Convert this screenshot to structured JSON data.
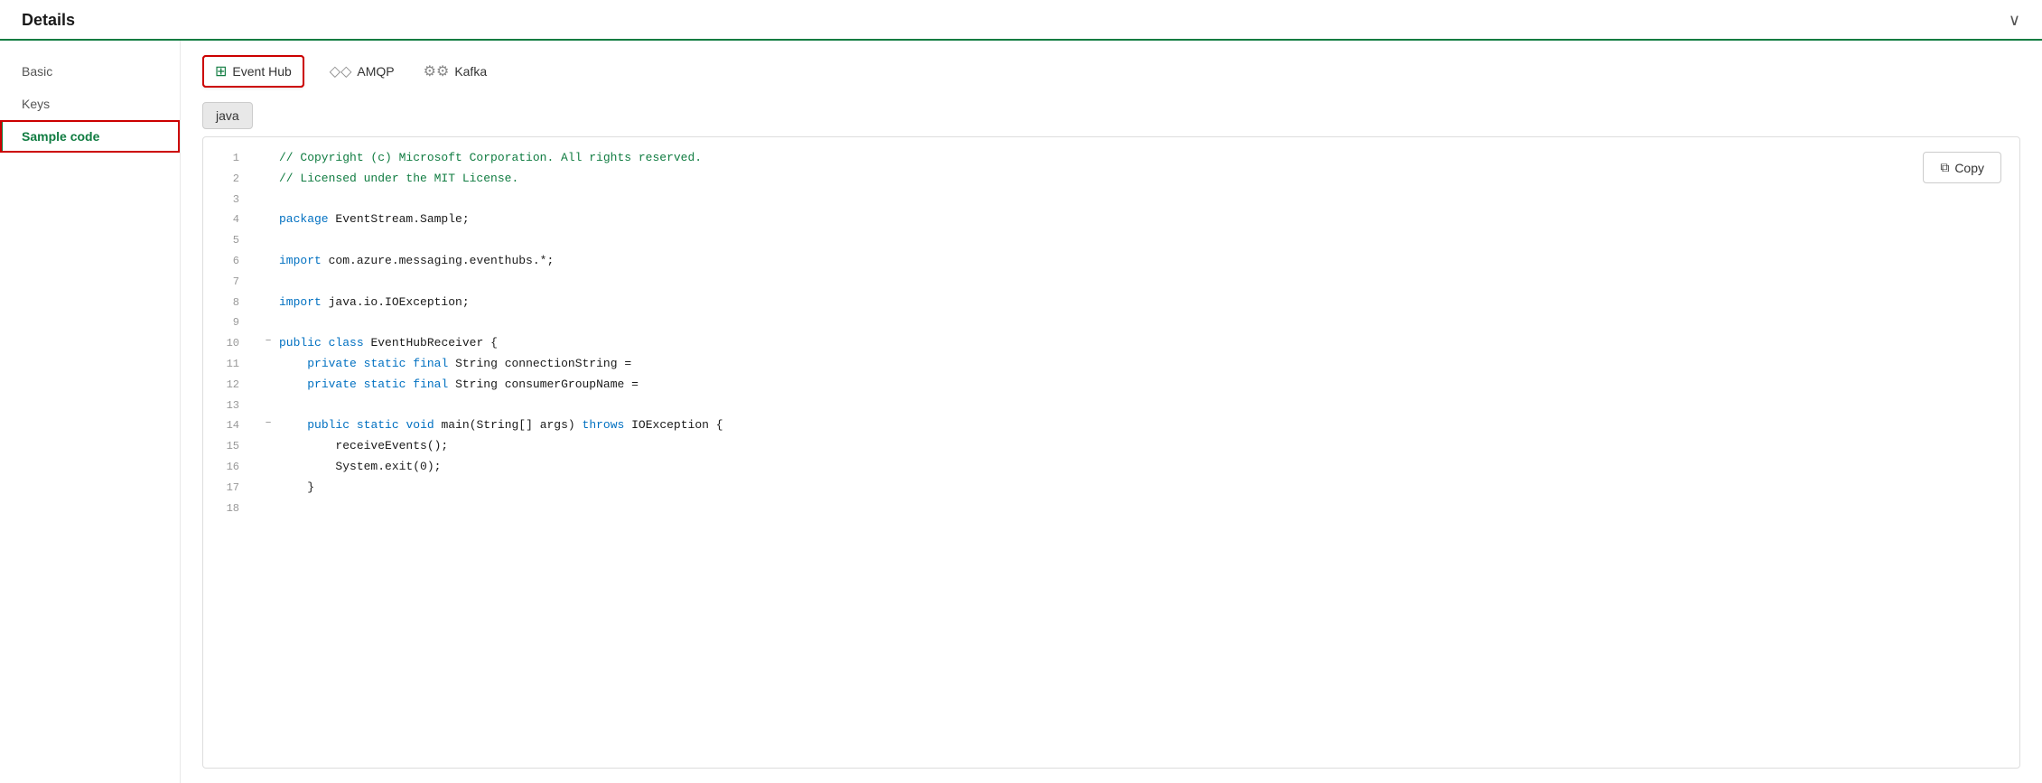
{
  "header": {
    "title": "Details",
    "chevron": "∨"
  },
  "sidebar": {
    "items": [
      {
        "id": "basic",
        "label": "Basic",
        "active": false
      },
      {
        "id": "keys",
        "label": "Keys",
        "active": false
      },
      {
        "id": "sample-code",
        "label": "Sample code",
        "active": true
      }
    ]
  },
  "protocol_tabs": [
    {
      "id": "event-hub",
      "label": "Event Hub",
      "icon": "⊞",
      "selected": true
    },
    {
      "id": "amqp",
      "label": "AMQP",
      "icon": "◇◇",
      "selected": false
    },
    {
      "id": "kafka",
      "label": "Kafka",
      "icon": "⚙⚙",
      "selected": false
    }
  ],
  "language_tab": {
    "label": "java"
  },
  "copy_button": {
    "label": "Copy",
    "icon": "⧉"
  },
  "code": {
    "lines": [
      {
        "num": 1,
        "collapse": "",
        "tokens": [
          {
            "type": "comment",
            "text": "// Copyright (c) Microsoft Corporation. All rights reserved."
          }
        ]
      },
      {
        "num": 2,
        "collapse": "",
        "tokens": [
          {
            "type": "comment",
            "text": "// Licensed under the MIT License."
          }
        ]
      },
      {
        "num": 3,
        "collapse": "",
        "tokens": []
      },
      {
        "num": 4,
        "collapse": "",
        "tokens": [
          {
            "type": "kw",
            "text": "package"
          },
          {
            "type": "plain",
            "text": " EventStream.Sample;"
          }
        ]
      },
      {
        "num": 5,
        "collapse": "",
        "tokens": []
      },
      {
        "num": 6,
        "collapse": "",
        "tokens": [
          {
            "type": "kw",
            "text": "import"
          },
          {
            "type": "plain",
            "text": " com.azure.messaging.eventhubs.*;"
          }
        ]
      },
      {
        "num": 7,
        "collapse": "",
        "tokens": []
      },
      {
        "num": 8,
        "collapse": "",
        "tokens": [
          {
            "type": "kw",
            "text": "import"
          },
          {
            "type": "plain",
            "text": " java.io.IOException;"
          }
        ]
      },
      {
        "num": 9,
        "collapse": "",
        "tokens": []
      },
      {
        "num": 10,
        "collapse": "−",
        "tokens": [
          {
            "type": "kw",
            "text": "public"
          },
          {
            "type": "plain",
            "text": " "
          },
          {
            "type": "kw",
            "text": "class"
          },
          {
            "type": "plain",
            "text": " EventHubReceiver {"
          }
        ]
      },
      {
        "num": 11,
        "collapse": "",
        "tokens": [
          {
            "type": "plain",
            "text": "    "
          },
          {
            "type": "kw",
            "text": "private"
          },
          {
            "type": "plain",
            "text": " "
          },
          {
            "type": "kw",
            "text": "static"
          },
          {
            "type": "plain",
            "text": " "
          },
          {
            "type": "kw",
            "text": "final"
          },
          {
            "type": "plain",
            "text": " String connectionString ="
          }
        ]
      },
      {
        "num": 12,
        "collapse": "",
        "tokens": [
          {
            "type": "plain",
            "text": "    "
          },
          {
            "type": "kw",
            "text": "private"
          },
          {
            "type": "plain",
            "text": " "
          },
          {
            "type": "kw",
            "text": "static"
          },
          {
            "type": "plain",
            "text": " "
          },
          {
            "type": "kw",
            "text": "final"
          },
          {
            "type": "plain",
            "text": " String consumerGroupName ="
          }
        ]
      },
      {
        "num": 13,
        "collapse": "",
        "tokens": []
      },
      {
        "num": 14,
        "collapse": "−",
        "tokens": [
          {
            "type": "plain",
            "text": "    "
          },
          {
            "type": "kw",
            "text": "public"
          },
          {
            "type": "plain",
            "text": " "
          },
          {
            "type": "kw",
            "text": "static"
          },
          {
            "type": "plain",
            "text": " "
          },
          {
            "type": "kw",
            "text": "void"
          },
          {
            "type": "plain",
            "text": " main(String[] args) "
          },
          {
            "type": "kw",
            "text": "throws"
          },
          {
            "type": "plain",
            "text": " IOException {"
          }
        ]
      },
      {
        "num": 15,
        "collapse": "",
        "tokens": [
          {
            "type": "plain",
            "text": "        receiveEvents();"
          }
        ]
      },
      {
        "num": 16,
        "collapse": "",
        "tokens": [
          {
            "type": "plain",
            "text": "        System.exit(0);"
          }
        ]
      },
      {
        "num": 17,
        "collapse": "",
        "tokens": [
          {
            "type": "plain",
            "text": "    }"
          }
        ]
      },
      {
        "num": 18,
        "collapse": "",
        "tokens": []
      }
    ]
  }
}
